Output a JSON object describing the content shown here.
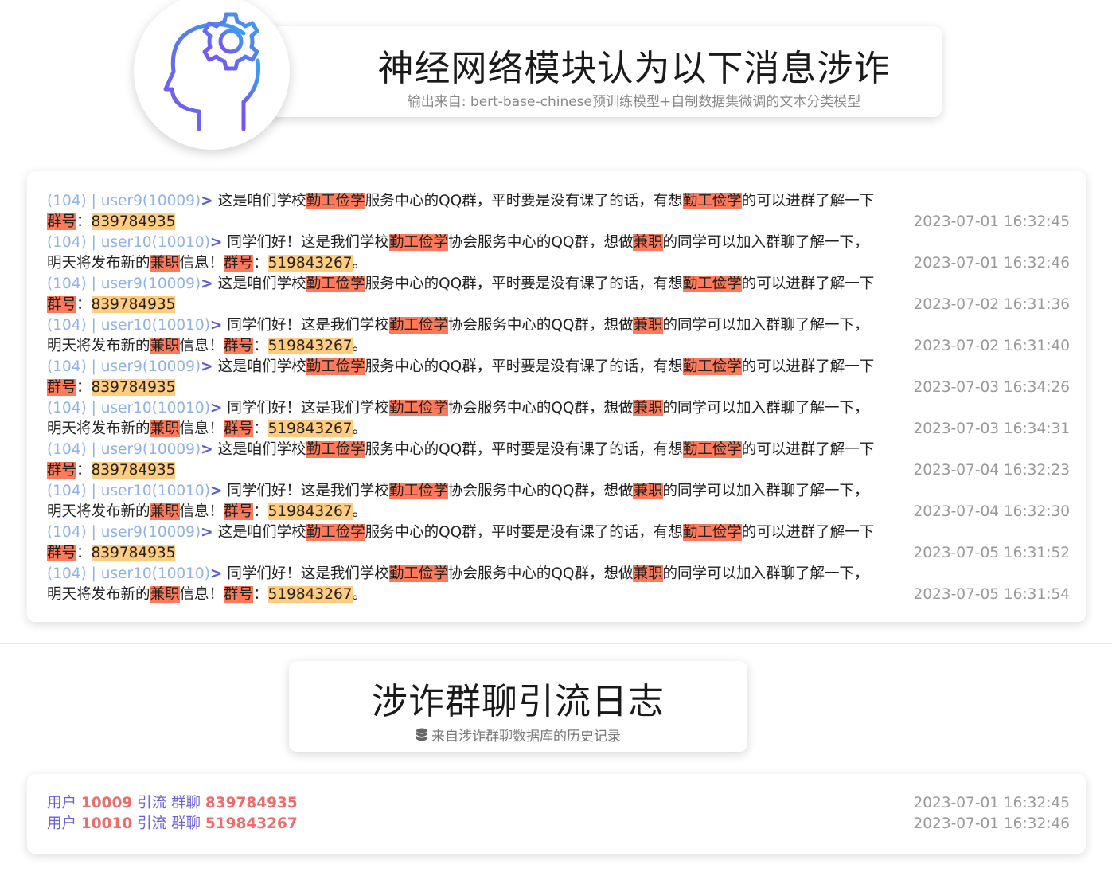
{
  "header": {
    "title": "神经网络模块认为以下消息涉诈",
    "subtitle": "输出来自: bert-base-chinese预训练模型+自制数据集微调的文本分类模型",
    "icon": "head-gear-icon",
    "icon_gradient": [
      "#3aa0f0",
      "#7b4ff0"
    ]
  },
  "messages": [
    {
      "meta": "(104) | user9(10009)",
      "parts": [
        [
          "t",
          "这是咱们学校"
        ],
        [
          "h",
          "勤工俭学"
        ],
        [
          "t",
          "服务中心的QQ群，平时要是没有课了的话，有想"
        ],
        [
          "h",
          "勤工俭学"
        ],
        [
          "t",
          "的可以进群了解一下"
        ],
        [
          "h",
          "群号"
        ],
        [
          "t",
          "："
        ],
        [
          "n",
          "839784935"
        ]
      ],
      "time": "2023-07-01 16:32:45"
    },
    {
      "meta": "(104) | user10(10010)",
      "parts": [
        [
          "t",
          "同学们好！这是我们学校"
        ],
        [
          "h",
          "勤工俭学"
        ],
        [
          "t",
          "协会服务中心的QQ群，想做"
        ],
        [
          "h",
          "兼职"
        ],
        [
          "t",
          "的同学可以加入群聊了解一下，明天将发布新的"
        ],
        [
          "h",
          "兼职"
        ],
        [
          "t",
          "信息！"
        ],
        [
          "h",
          "群号"
        ],
        [
          "t",
          "："
        ],
        [
          "n",
          "519843267"
        ],
        [
          "t",
          "。"
        ]
      ],
      "time": "2023-07-01 16:32:46"
    },
    {
      "meta": "(104) | user9(10009)",
      "parts": [
        [
          "t",
          "这是咱们学校"
        ],
        [
          "h",
          "勤工俭学"
        ],
        [
          "t",
          "服务中心的QQ群，平时要是没有课了的话，有想"
        ],
        [
          "h",
          "勤工俭学"
        ],
        [
          "t",
          "的可以进群了解一下"
        ],
        [
          "h",
          "群号"
        ],
        [
          "t",
          "："
        ],
        [
          "n",
          "839784935"
        ]
      ],
      "time": "2023-07-02 16:31:36"
    },
    {
      "meta": "(104) | user10(10010)",
      "parts": [
        [
          "t",
          "同学们好！这是我们学校"
        ],
        [
          "h",
          "勤工俭学"
        ],
        [
          "t",
          "协会服务中心的QQ群，想做"
        ],
        [
          "h",
          "兼职"
        ],
        [
          "t",
          "的同学可以加入群聊了解一下，明天将发布新的"
        ],
        [
          "h",
          "兼职"
        ],
        [
          "t",
          "信息！"
        ],
        [
          "h",
          "群号"
        ],
        [
          "t",
          "："
        ],
        [
          "n",
          "519843267"
        ],
        [
          "t",
          "。"
        ]
      ],
      "time": "2023-07-02 16:31:40"
    },
    {
      "meta": "(104) | user9(10009)",
      "parts": [
        [
          "t",
          "这是咱们学校"
        ],
        [
          "h",
          "勤工俭学"
        ],
        [
          "t",
          "服务中心的QQ群，平时要是没有课了的话，有想"
        ],
        [
          "h",
          "勤工俭学"
        ],
        [
          "t",
          "的可以进群了解一下"
        ],
        [
          "h",
          "群号"
        ],
        [
          "t",
          "："
        ],
        [
          "n",
          "839784935"
        ]
      ],
      "time": "2023-07-03 16:34:26"
    },
    {
      "meta": "(104) | user10(10010)",
      "parts": [
        [
          "t",
          "同学们好！这是我们学校"
        ],
        [
          "h",
          "勤工俭学"
        ],
        [
          "t",
          "协会服务中心的QQ群，想做"
        ],
        [
          "h",
          "兼职"
        ],
        [
          "t",
          "的同学可以加入群聊了解一下，明天将发布新的"
        ],
        [
          "h",
          "兼职"
        ],
        [
          "t",
          "信息！"
        ],
        [
          "h",
          "群号"
        ],
        [
          "t",
          "："
        ],
        [
          "n",
          "519843267"
        ],
        [
          "t",
          "。"
        ]
      ],
      "time": "2023-07-03 16:34:31"
    },
    {
      "meta": "(104) | user9(10009)",
      "parts": [
        [
          "t",
          "这是咱们学校"
        ],
        [
          "h",
          "勤工俭学"
        ],
        [
          "t",
          "服务中心的QQ群，平时要是没有课了的话，有想"
        ],
        [
          "h",
          "勤工俭学"
        ],
        [
          "t",
          "的可以进群了解一下"
        ],
        [
          "h",
          "群号"
        ],
        [
          "t",
          "："
        ],
        [
          "n",
          "839784935"
        ]
      ],
      "time": "2023-07-04 16:32:23"
    },
    {
      "meta": "(104) | user10(10010)",
      "parts": [
        [
          "t",
          "同学们好！这是我们学校"
        ],
        [
          "h",
          "勤工俭学"
        ],
        [
          "t",
          "协会服务中心的QQ群，想做"
        ],
        [
          "h",
          "兼职"
        ],
        [
          "t",
          "的同学可以加入群聊了解一下，明天将发布新的"
        ],
        [
          "h",
          "兼职"
        ],
        [
          "t",
          "信息！"
        ],
        [
          "h",
          "群号"
        ],
        [
          "t",
          "："
        ],
        [
          "n",
          "519843267"
        ],
        [
          "t",
          "。"
        ]
      ],
      "time": "2023-07-04 16:32:30"
    },
    {
      "meta": "(104) | user9(10009)",
      "parts": [
        [
          "t",
          "这是咱们学校"
        ],
        [
          "h",
          "勤工俭学"
        ],
        [
          "t",
          "服务中心的QQ群，平时要是没有课了的话，有想"
        ],
        [
          "h",
          "勤工俭学"
        ],
        [
          "t",
          "的可以进群了解一下"
        ],
        [
          "h",
          "群号"
        ],
        [
          "t",
          "："
        ],
        [
          "n",
          "839784935"
        ]
      ],
      "time": "2023-07-05 16:31:52"
    },
    {
      "meta": "(104) | user10(10010)",
      "parts": [
        [
          "t",
          "同学们好！这是我们学校"
        ],
        [
          "h",
          "勤工俭学"
        ],
        [
          "t",
          "协会服务中心的QQ群，想做"
        ],
        [
          "h",
          "兼职"
        ],
        [
          "t",
          "的同学可以加入群聊了解一下，明天将发布新的"
        ],
        [
          "h",
          "兼职"
        ],
        [
          "t",
          "信息！"
        ],
        [
          "h",
          "群号"
        ],
        [
          "t",
          "："
        ],
        [
          "n",
          "519843267"
        ],
        [
          "t",
          "。"
        ]
      ],
      "time": "2023-07-05 16:31:54"
    }
  ],
  "arrow": ">",
  "highlight_colors": {
    "keyword": "#ff7a5a",
    "number": "#ffcc80"
  },
  "log_header": {
    "title": "涉诈群聊引流日志",
    "subtitle": "来自涉诈群聊数据库的历史记录",
    "icon": "database-icon"
  },
  "logs": [
    {
      "w1": "用户",
      "user": "10009",
      "w2": "引流 群聊",
      "group": "839784935",
      "time": "2023-07-01 16:32:45"
    },
    {
      "w1": "用户",
      "user": "10010",
      "w2": "引流 群聊",
      "group": "519843267",
      "time": "2023-07-01 16:32:46"
    }
  ]
}
